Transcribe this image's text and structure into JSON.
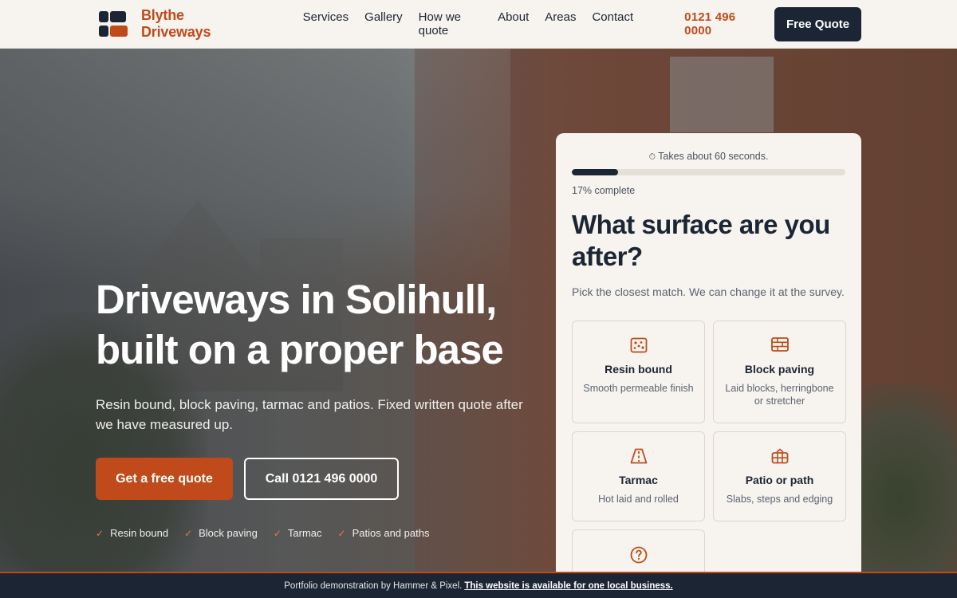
{
  "header": {
    "brand": "Blythe Driveways",
    "nav": [
      "Services",
      "Gallery",
      "How we quote",
      "About",
      "Areas",
      "Contact"
    ],
    "phone": "0121 496 0000",
    "cta": "Free Quote"
  },
  "hero": {
    "title_line1": "Driveways in Solihull,",
    "title_line2": "built on a proper base",
    "subtitle": "Resin bound, block paving, tarmac and patios. Fixed written quote after we have measured up.",
    "primary_cta": "Get a free quote",
    "secondary_cta": "Call 0121 496 0000",
    "features": [
      "Resin bound",
      "Block paving",
      "Tarmac",
      "Patios and paths"
    ]
  },
  "quote_card": {
    "timer": "Takes about 60 seconds.",
    "progress_fraction": 0.17,
    "progress_label": "17% complete",
    "question": "What surface are you after?",
    "hint": "Pick the closest match. We can change it at the survey.",
    "options": [
      {
        "title": "Resin bound",
        "desc": "Smooth permeable finish",
        "icon": "resin-icon"
      },
      {
        "title": "Block paving",
        "desc": "Laid blocks, herringbone or stretcher",
        "icon": "block-paving-icon"
      },
      {
        "title": "Tarmac",
        "desc": "Hot laid and rolled",
        "icon": "road-icon"
      },
      {
        "title": "Patio or path",
        "desc": "Slabs, steps and edging",
        "icon": "patio-icon"
      },
      {
        "title": "",
        "desc": "",
        "icon": "question-icon"
      }
    ]
  },
  "footer": {
    "text": "Portfolio demonstration by Hammer & Pixel.",
    "link": "This website is available for one local business."
  },
  "colors": {
    "accent": "#c04a1a",
    "navy": "#1c2533",
    "cream": "#f7f4ef"
  }
}
